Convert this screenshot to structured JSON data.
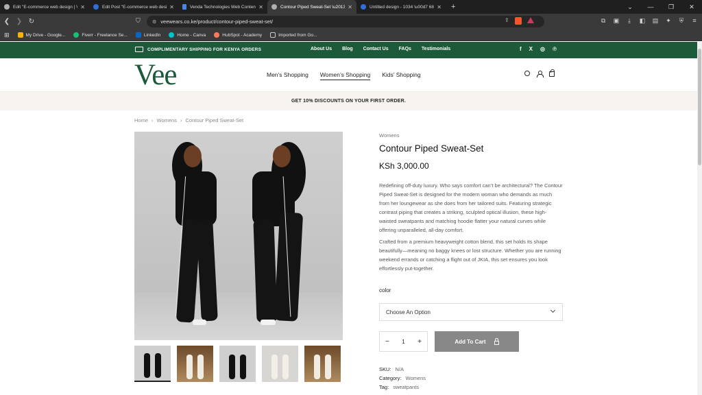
{
  "browser": {
    "tabs": [
      {
        "title": "Edit \"E-commerce web design | Vee \\u2026",
        "active": false
      },
      {
        "title": "Edit Post \"E-commerce web design |\\u2026",
        "active": false
      },
      {
        "title": "Venda Technologies Web Content Cr\\u2026",
        "active": false
      },
      {
        "title": "Contour Piped Sweat-Set \\u2013 Vee \\u2026",
        "active": true
      },
      {
        "title": "Untitled design - 1034 \\u00d7 681px",
        "active": false
      }
    ],
    "url": "veewears.co.ke/product/contour-piped-sweat-set/",
    "bookmarks": [
      "My Drive - Google...",
      "Fiverr - Freelance Se...",
      "LinkedIn",
      "Home - Canva",
      "HubSpot - Academy",
      "Imported from Go..."
    ],
    "colors": {
      "chrome_dark": "#1f1f1f",
      "chrome_mid": "#3a3a3a"
    }
  },
  "site": {
    "topbar": {
      "shipping": "COMPLIMENTARY SHIPPING FOR KENYA ORDERS",
      "links": [
        "About Us",
        "Blog",
        "Contact Us",
        "FAQs",
        "Testimonials"
      ],
      "social": [
        "f",
        "X",
        "instagram-icon",
        "pinterest-icon"
      ]
    },
    "logo": "Vee",
    "nav": [
      {
        "label": "Men’s Shopping",
        "active": false
      },
      {
        "label": "Women’s Shopping",
        "active": true
      },
      {
        "label": "Kids’ Shopping",
        "active": false
      }
    ],
    "promo": "GET 10% DISCOUNTS ON YOUR FIRST ORDER.",
    "colors": {
      "brand_green": "#1c5a3a",
      "promo_bg": "#f7f3ee",
      "button_gray": "#888888"
    }
  },
  "breadcrumb": {
    "home": "Home",
    "section": "Womens",
    "current": "Contour Piped Sweat-Set",
    "sep": "›"
  },
  "product": {
    "category": "Womens",
    "title": "Contour Piped Sweat-Set",
    "price": "KSh 3,000.00",
    "description": [
      "Redefining off-duty luxury. Who says comfort can’t be architectural? The Contour Piped Sweat-Set is designed for the modern woman who demands as much from her loungewear as she does from her tailored suits. Featuring strategic contrast piping that creates a striking, sculpted optical illusion, these high-waisted sweatpants and matching hoodie flatter your natural curves while offering unparalleled, all-day comfort.",
      "Crafted from a premium heavyweight cotton blend, this set holds its shape beautifully—meaning no baggy knees or lost structure. Whether you are running weekend errands or catching a flight out of JKIA, this set ensures you look effortlessly put-together."
    ],
    "color_label": "color",
    "color_select": "Choose An Option",
    "quantity": "1",
    "qty_minus": "−",
    "qty_plus": "+",
    "add_to_cart": "Add To Cart",
    "sku_label": "SKU:",
    "sku": "N/A",
    "category_label": "Category:",
    "category_value": "Womens",
    "tag_label": "Tag:",
    "tag": "sweatpants",
    "thumbnails": 5
  }
}
